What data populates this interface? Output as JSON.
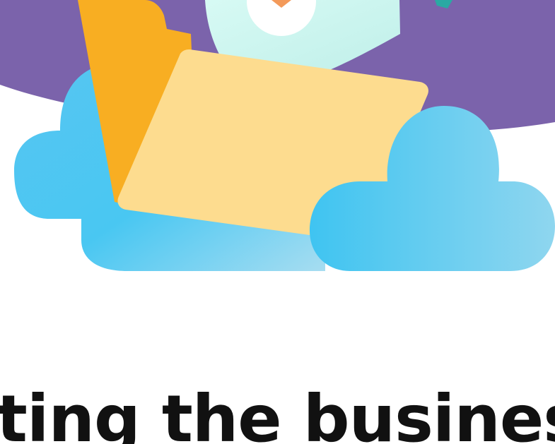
{
  "headline": {
    "text": "ecting the busines"
  },
  "illustration": {
    "icons": [
      "folder-icon",
      "cloud-icon",
      "document-icon",
      "checkmark-badge-icon"
    ],
    "colors": {
      "purple_banner": "#7B63AB",
      "folder_back": "#F8AE22",
      "folder_front": "#FDDC8F",
      "cloud": "#43C4F0",
      "cloud_light": "#9AD8F0",
      "document": "#C8F4EE",
      "badge": "#FFFFFF",
      "check": "#F39A5A",
      "teal_accent": "#2AA9A3"
    }
  }
}
